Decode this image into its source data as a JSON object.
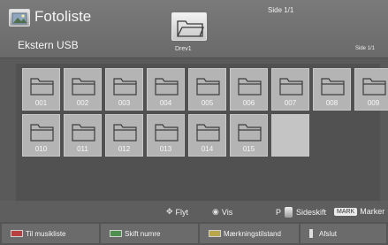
{
  "header": {
    "app_title": "Fotoliste",
    "page_indicator_top": "Side 1/1",
    "source": "Ekstern USB",
    "drive": "Drev1",
    "page_indicator_right": "Side 1/1"
  },
  "folders": [
    "001",
    "002",
    "003",
    "004",
    "005",
    "006",
    "007",
    "008",
    "009",
    "010",
    "011",
    "012",
    "013",
    "014",
    "015"
  ],
  "hints": {
    "move": "Flyt",
    "view": "Vis",
    "page_prefix": "P",
    "page_change": "Sideskift",
    "mark_key": "MARK",
    "mark": "Marker"
  },
  "functions": {
    "red": "Til musikliste",
    "green": "Skift numre",
    "yellow": "Mærkningstilstand",
    "exit": "Afslut"
  }
}
